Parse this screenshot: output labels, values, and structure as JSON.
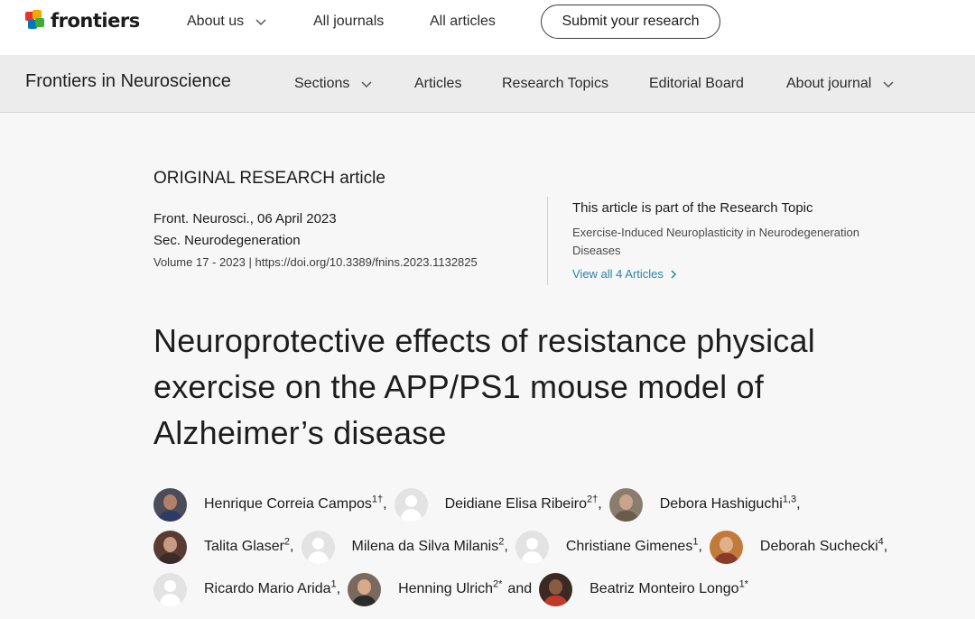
{
  "topnav": {
    "brand": "frontiers",
    "items": [
      {
        "label": "About us",
        "dropdown": true
      },
      {
        "label": "All journals",
        "dropdown": false
      },
      {
        "label": "All articles",
        "dropdown": false
      }
    ],
    "submit_label": "Submit your research"
  },
  "journalnav": {
    "title": "Frontiers in Neuroscience",
    "items": [
      {
        "label": "Sections",
        "dropdown": true
      },
      {
        "label": "Articles",
        "dropdown": false
      },
      {
        "label": "Research Topics",
        "dropdown": false
      },
      {
        "label": "Editorial Board",
        "dropdown": false
      },
      {
        "label": "About journal",
        "dropdown": true
      }
    ]
  },
  "article": {
    "type_prefix": "ORIGINAL RESEARCH",
    "type_suffix": " article",
    "journal_date": "Front. Neurosci., 06 April 2023",
    "section": "Sec. Neurodegeneration",
    "volume_doi": "Volume 17 - 2023 | https://doi.org/10.3389/fnins.2023.1132825",
    "title": "Neuroprotective effects of resistance physical exercise on the APP/PS1 mouse model of Alzheimer’s disease"
  },
  "research_topic": {
    "heading": "This article is part of the Research Topic",
    "name": "Exercise-Induced Neuroplasticity in Neurodegeneration Diseases",
    "link_label": "View all 4 Articles"
  },
  "authors": {
    "row1": [
      {
        "name": "Henrique Correia Campos",
        "sup": "1†",
        "sep": ","
      },
      {
        "name": "Deidiane Elisa Ribeiro",
        "sup": "2†",
        "sep": ","
      },
      {
        "name": "Debora Hashiguchi",
        "sup": "1,3",
        "sep": ","
      }
    ],
    "row2": [
      {
        "name": "Talita Glaser",
        "sup": "2",
        "sep": ","
      },
      {
        "name": "Milena da Silva Milanis",
        "sup": "2",
        "sep": ","
      },
      {
        "name": "Christiane Gimenes",
        "sup": "1",
        "sep": ","
      },
      {
        "name": "Deborah Suchecki",
        "sup": "4",
        "sep": ","
      }
    ],
    "row3": [
      {
        "name": "Ricardo Mario Arida",
        "sup": "1",
        "sep": ","
      },
      {
        "name": "Henning Ulrich",
        "sup": "2*",
        "sep": ""
      },
      {
        "name": "Beatriz Monteiro Longo",
        "sup": "1*",
        "sep": ""
      }
    ],
    "and_label": "and"
  },
  "colors": {
    "link": "#2a84a6",
    "nav_bg": "#ececec",
    "page_bg": "#f7f7f7"
  }
}
